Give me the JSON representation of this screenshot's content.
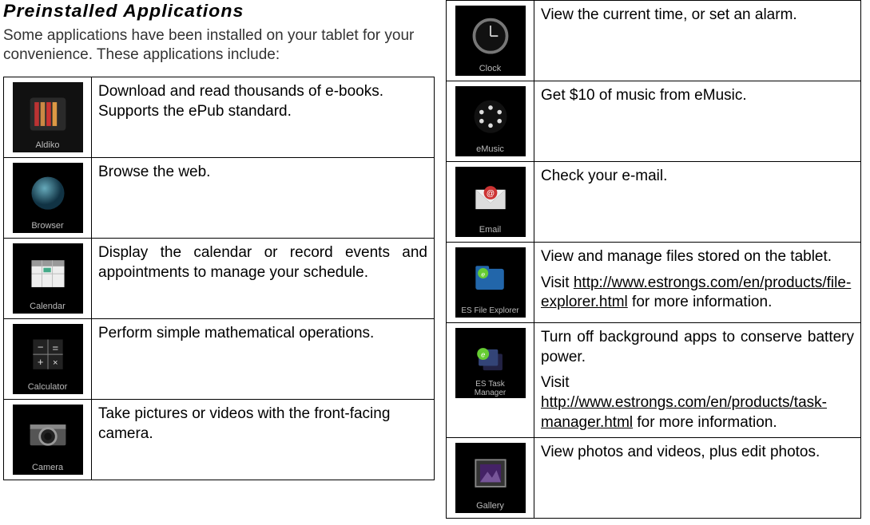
{
  "title": "Preinstalled Applications",
  "intro": "Some applications have been installed on your tablet for your convenience. These applications include:",
  "left_apps": [
    {
      "name": "Aldiko",
      "desc": "Download and read thousands of e-books. Supports the ePub standard."
    },
    {
      "name": "Browser",
      "desc": "Browse the web."
    },
    {
      "name": "Calendar",
      "desc": "Display the calendar or record events and appointments to manage your schedule."
    },
    {
      "name": "Calculator",
      "desc": "Perform simple mathematical operations."
    },
    {
      "name": "Camera",
      "desc": "Take pictures or videos with the front-facing camera."
    }
  ],
  "right_apps": [
    {
      "name": "Clock",
      "desc": "View the current time, or set an alarm."
    },
    {
      "name": "eMusic",
      "desc": "Get $10 of music from eMusic."
    },
    {
      "name": "Email",
      "desc": "Check your e-mail."
    },
    {
      "name": "ES File Explorer",
      "desc": "View and manage files stored on the tablet.",
      "visit_pre": "Visit   ",
      "link": "http://www.estrongs.com/en/products/file-explorer.html",
      "visit_post": " for more information."
    },
    {
      "name": "ES Task Manager",
      "desc": "Turn off background apps to conserve battery power.",
      "visit_pre": "Visit   ",
      "link": "http://www.estrongs.com/en/products/task-manager.html",
      "visit_post": " for more information."
    },
    {
      "name": "Gallery",
      "desc": "View photos and videos, plus edit photos."
    }
  ]
}
